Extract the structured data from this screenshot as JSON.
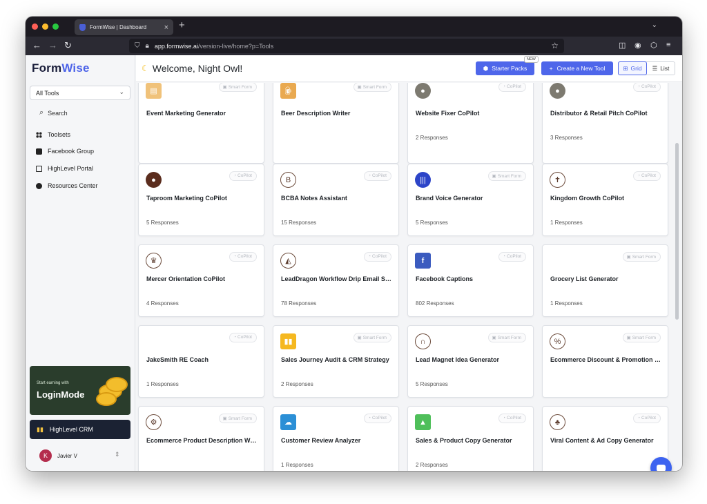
{
  "browser": {
    "tab_title": "FormWise | Dashboard",
    "url_domain": "app.formwise.ai",
    "url_path": "/version-live/home?p=Tools"
  },
  "sidebar": {
    "logo_prefix": "Form",
    "logo_suffix": "Wise",
    "select_label": "All Tools",
    "search_label": "Search",
    "items": [
      {
        "label": "Toolsets",
        "icon": "toolsets-icon"
      },
      {
        "label": "Facebook Group",
        "icon": "facebook-icon"
      },
      {
        "label": "HighLevel Portal",
        "icon": "portal-icon"
      },
      {
        "label": "Resources Center",
        "icon": "info-icon"
      }
    ],
    "promo_small": "Start earning with",
    "promo_big": "LoginMode",
    "crm_label": "HighLevel CRM",
    "user_initial": "K",
    "user_name": "Javier V"
  },
  "header": {
    "welcome": "Welcome, Night Owl!",
    "starter_label": "Starter Packs",
    "new_badge": "NEW",
    "create_label": "Create a New Tool",
    "grid_label": "Grid",
    "list_label": "List"
  },
  "colors": {
    "accent": "#4e66ea",
    "tag_text": "#b3b7be"
  },
  "cards": [
    {
      "title": "Event Marketing Generator",
      "tag": "Smart Form",
      "responses": "",
      "icon": "document-icon",
      "icon_color": "#f0c27a"
    },
    {
      "title": "Beer Description Writer",
      "tag": "Smart Form",
      "responses": "",
      "icon": "beer-icon",
      "icon_color": "#e9a950"
    },
    {
      "title": "Website Fixer CoPilot",
      "tag": "CoPilot",
      "responses": "2 Responses",
      "icon": "avatar-icon",
      "icon_color": "#7d7a70"
    },
    {
      "title": "Distributor & Retail Pitch CoPilot",
      "tag": "CoPilot",
      "responses": "3 Responses",
      "icon": "avatar-icon",
      "icon_color": "#7d7a70"
    },
    {
      "title": "Taproom Marketing CoPilot",
      "tag": "CoPilot",
      "responses": "5 Responses",
      "icon": "avatar-icon",
      "icon_color": "#5b2d1e"
    },
    {
      "title": "BCBA Notes Assistant",
      "tag": "CoPilot",
      "responses": "15 Responses",
      "icon": "bcba-logo-icon",
      "icon_color": "#ffffff"
    },
    {
      "title": "Brand Voice Generator",
      "tag": "Smart Form",
      "responses": "5 Responses",
      "icon": "soundwave-icon",
      "icon_color": "#2d45c8"
    },
    {
      "title": "Kingdom Growth CoPilot",
      "tag": "CoPilot",
      "responses": "1 Responses",
      "icon": "cross-icon",
      "icon_color": "#ffffff"
    },
    {
      "title": "Mercer Orientation CoPilot",
      "tag": "CoPilot",
      "responses": "4 Responses",
      "icon": "lion-icon",
      "icon_color": "#ffffff"
    },
    {
      "title": "LeadDragon Workflow Drip Email Sequence",
      "tag": "CoPilot",
      "responses": "78 Responses",
      "icon": "paint-bucket-icon",
      "icon_color": "#ffffff"
    },
    {
      "title": "Facebook Captions",
      "tag": "CoPilot",
      "responses": "802 Responses",
      "icon": "facebook-icon",
      "icon_color": "#3b5bbf"
    },
    {
      "title": "Grocery List Generator",
      "tag": "Smart Form",
      "responses": "1 Responses",
      "icon": "",
      "icon_color": ""
    },
    {
      "title": "JakeSmith RE Coach",
      "tag": "CoPilot",
      "responses": "1 Responses",
      "icon": "",
      "icon_color": ""
    },
    {
      "title": "Sales Journey Audit & CRM Strategy",
      "tag": "Smart Form",
      "responses": "2 Responses",
      "icon": "bar-chart-icon",
      "icon_color": "#f5b820"
    },
    {
      "title": "Lead Magnet Idea Generator",
      "tag": "Smart Form",
      "responses": "5 Responses",
      "icon": "magnet-icon",
      "icon_color": "#ffffff"
    },
    {
      "title": "Ecommerce Discount & Promotion Ideas",
      "tag": "Smart Form",
      "responses": "",
      "icon": "discount-icon",
      "icon_color": "#ffffff"
    },
    {
      "title": "Ecommerce Product Description Writer",
      "tag": "Smart Form",
      "responses": "",
      "icon": "gear-icon",
      "icon_color": "#ffffff"
    },
    {
      "title": "Customer Review Analyzer",
      "tag": "CoPilot",
      "responses": "1 Responses",
      "icon": "cloud-icon",
      "icon_color": "#2b8fd6"
    },
    {
      "title": "Sales & Product Copy Generator",
      "tag": "CoPilot",
      "responses": "2 Responses",
      "icon": "growth-chart-icon",
      "icon_color": "#4fbf5a"
    },
    {
      "title": "Viral Content & Ad Copy Generator",
      "tag": "CoPilot",
      "responses": "",
      "icon": "people-network-icon",
      "icon_color": "#ffffff"
    }
  ]
}
